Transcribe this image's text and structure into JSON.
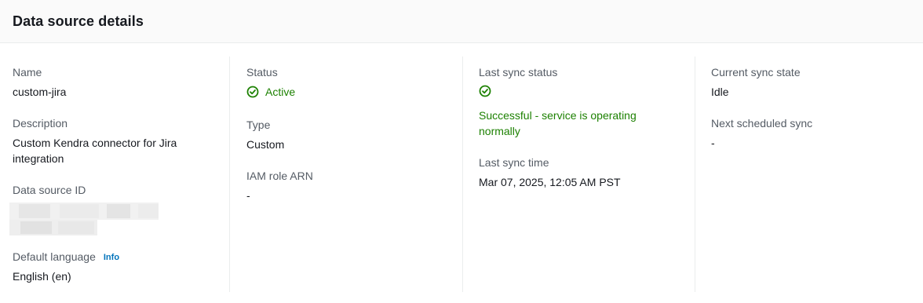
{
  "header": {
    "title": "Data source details"
  },
  "col1": {
    "name_label": "Name",
    "name_value": "custom-jira",
    "description_label": "Description",
    "description_value": "Custom Kendra connector for Jira integration",
    "id_label": "Data source ID",
    "language_label": "Default language",
    "language_info": "Info",
    "language_value": "English (en)"
  },
  "col2": {
    "status_label": "Status",
    "status_value": "Active",
    "type_label": "Type",
    "type_value": "Custom",
    "iam_label": "IAM role ARN",
    "iam_value": "-"
  },
  "col3": {
    "last_sync_status_label": "Last sync status",
    "last_sync_status_value": "Successful - service is operating normally",
    "last_sync_time_label": "Last sync time",
    "last_sync_time_value": "Mar 07, 2025, 12:05 AM PST"
  },
  "col4": {
    "current_state_label": "Current sync state",
    "current_state_value": "Idle",
    "next_sync_label": "Next scheduled sync",
    "next_sync_value": "-"
  },
  "colors": {
    "success": "#1d8102",
    "link": "#0073bb",
    "label": "#545b64",
    "text": "#16191f"
  },
  "icons": {
    "status_icon": "status-positive-icon"
  }
}
